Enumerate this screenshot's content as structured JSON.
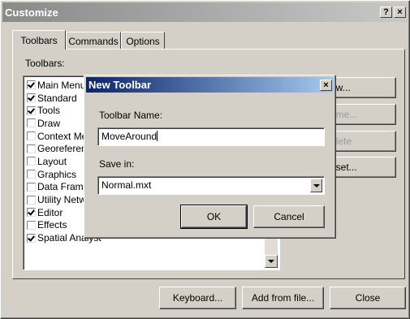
{
  "customize": {
    "title": "Customize",
    "help_glyph": "?",
    "close_glyph": "×",
    "tabs": [
      {
        "label": "Toolbars"
      },
      {
        "label": "Commands"
      },
      {
        "label": "Options"
      }
    ],
    "toolbars_label": "Toolbars:",
    "toolbar_items": [
      {
        "label": "Main Menu",
        "checked": true
      },
      {
        "label": "Standard",
        "checked": true
      },
      {
        "label": "Tools",
        "checked": true
      },
      {
        "label": "Draw",
        "checked": false
      },
      {
        "label": "Context Me",
        "checked": false
      },
      {
        "label": "Georeferen",
        "checked": false
      },
      {
        "label": "Layout",
        "checked": false
      },
      {
        "label": "Graphics",
        "checked": false
      },
      {
        "label": "Data Frame",
        "checked": false
      },
      {
        "label": "Utility Netw",
        "checked": false
      },
      {
        "label": "Editor",
        "checked": true
      },
      {
        "label": "Effects",
        "checked": false
      },
      {
        "label": "Spatial Analyst",
        "checked": true
      }
    ],
    "side_buttons": {
      "new_label": "ew...",
      "rename_label": "ame...",
      "delete_label": "elete",
      "reset_label": "eset..."
    },
    "bottom_buttons": {
      "keyboard_label": "Keyboard...",
      "add_from_file_label": "Add from file...",
      "close_label": "Close"
    }
  },
  "new_toolbar": {
    "title": "New Toolbar",
    "close_glyph": "×",
    "name_label": "Toolbar Name:",
    "name_value": "MoveAround",
    "save_in_label": "Save in:",
    "save_in_value": "Normal.mxt",
    "ok_label": "OK",
    "cancel_label": "Cancel"
  },
  "colors": {
    "active_title_start": "#0a246a",
    "active_title_end": "#a6caf0",
    "inactive_title_start": "#808080",
    "inactive_title_end": "#c0c0c0",
    "face": "#d4d0c8",
    "desktop": "#3a6ea5"
  }
}
